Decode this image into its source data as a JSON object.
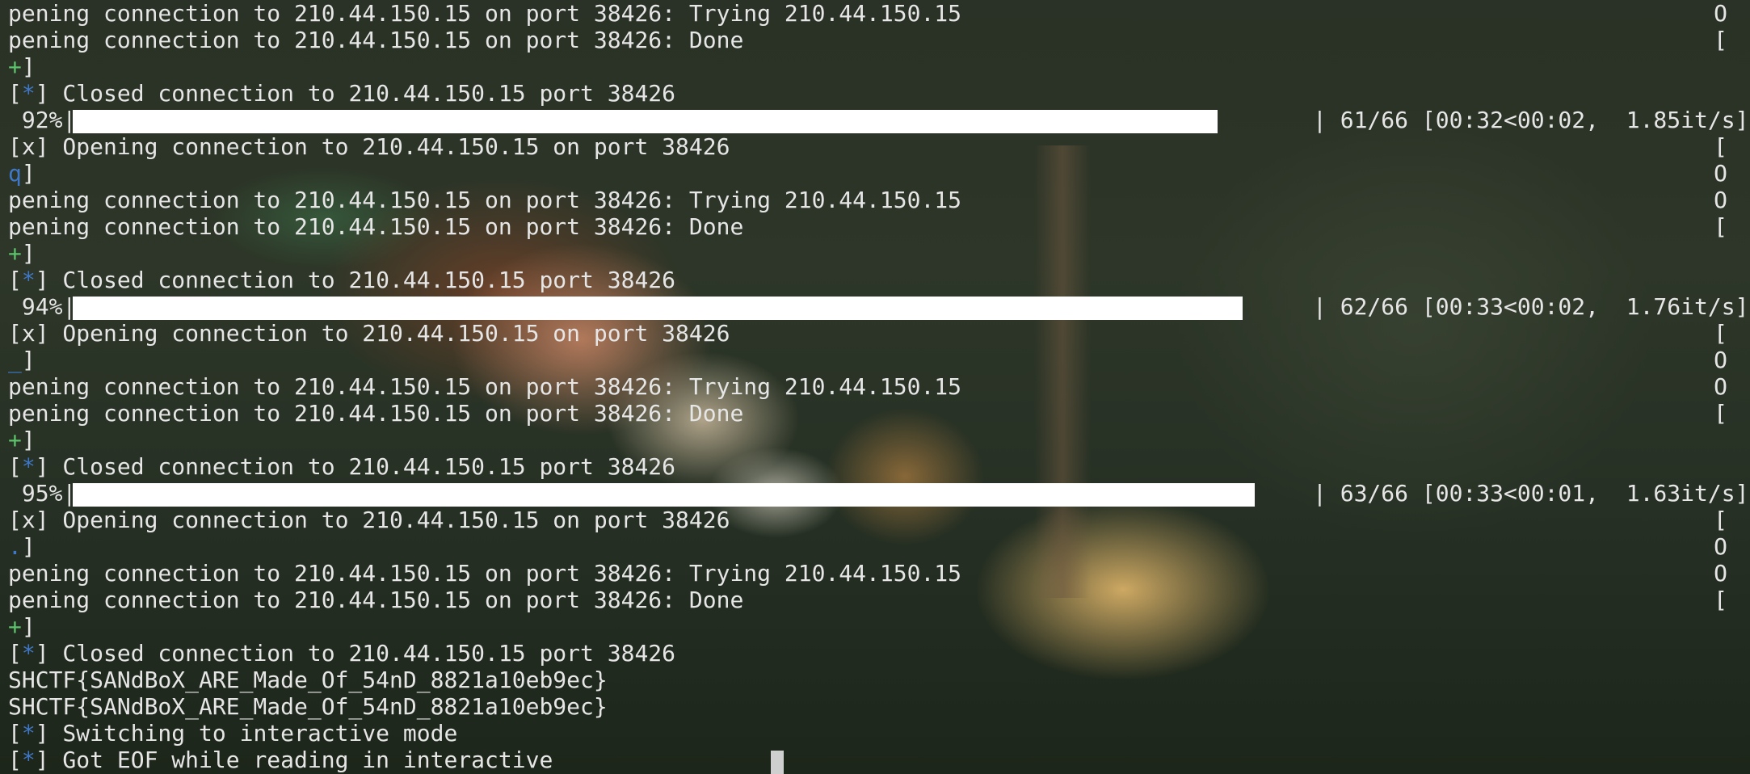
{
  "terminal": {
    "progress_rows": [
      {
        "percent_label": " 92%|",
        "progress": 0.92,
        "meta": "| 61/66 [00:32<00:02,  1.85it/s]"
      },
      {
        "percent_label": " 94%|",
        "progress": 0.94,
        "meta": "| 62/66 [00:33<00:02,  1.76it/s]"
      },
      {
        "percent_label": " 95%|",
        "progress": 0.95,
        "meta": "| 63/66 [00:33<00:01,  1.63it/s]"
      }
    ],
    "lines": {
      "l0": {
        "text": "pening connection to 210.44.150.15 on port 38426: Trying 210.44.150.15",
        "right": "O"
      },
      "l1": {
        "text": "pening connection to 210.44.150.15 on port 38426: Done",
        "right": "["
      },
      "l2": {
        "mark": "+",
        "close": "]"
      },
      "l3": {
        "open": "[",
        "mark": "*",
        "rest": "] Closed connection to 210.44.150.15 port 38426"
      },
      "l5": {
        "text": "[x] Opening connection to 210.44.150.15 on port 38426",
        "right": "["
      },
      "l6": {
        "mark": "q",
        "close": "]",
        "right": "O"
      },
      "l7": {
        "text": "pening connection to 210.44.150.15 on port 38426: Trying 210.44.150.15",
        "right": "O"
      },
      "l8": {
        "text": "pening connection to 210.44.150.15 on port 38426: Done",
        "right": "["
      },
      "l9": {
        "mark": "+",
        "close": "]"
      },
      "l10": {
        "open": "[",
        "mark": "*",
        "rest": "] Closed connection to 210.44.150.15 port 38426"
      },
      "l12": {
        "text": "[x] Opening connection to 210.44.150.15 on port 38426",
        "right": "["
      },
      "l13": {
        "mark": "_",
        "close": "]",
        "right": "O"
      },
      "l14": {
        "text": "pening connection to 210.44.150.15 on port 38426: Trying 210.44.150.15",
        "right": "O"
      },
      "l15": {
        "text": "pening connection to 210.44.150.15 on port 38426: Done",
        "right": "["
      },
      "l16": {
        "mark": "+",
        "close": "]"
      },
      "l17": {
        "open": "[",
        "mark": "*",
        "rest": "] Closed connection to 210.44.150.15 port 38426"
      },
      "l19": {
        "text": "[x] Opening connection to 210.44.150.15 on port 38426",
        "right": "["
      },
      "l20": {
        "mark": ".",
        "close": "]",
        "right": "O"
      },
      "l21": {
        "text": "pening connection to 210.44.150.15 on port 38426: Trying 210.44.150.15",
        "right": "O"
      },
      "l22": {
        "text": "pening connection to 210.44.150.15 on port 38426: Done",
        "right": "["
      },
      "l23": {
        "mark": "+",
        "close": "]"
      },
      "l24": {
        "open": "[",
        "mark": "*",
        "rest": "] Closed connection to 210.44.150.15 port 38426"
      },
      "l25": {
        "text": "SHCTF{SANdBoX_ARE_Made_Of_54nD_8821a10eb9ec}"
      },
      "l26": {
        "text": "SHCTF{SANdBoX_ARE_Made_Of_54nD_8821a10eb9ec}"
      },
      "l27": {
        "open": "[",
        "mark": "*",
        "rest": "] Switching to interactive mode"
      },
      "l28": {
        "open": "[",
        "mark": "*",
        "rest": "] Got EOF while reading in interactive"
      }
    }
  }
}
